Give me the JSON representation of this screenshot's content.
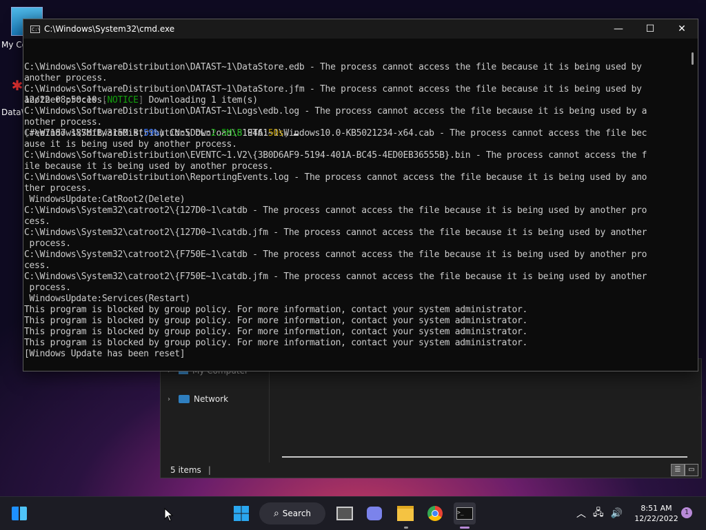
{
  "desktop": {
    "icons": [
      {
        "label": "My Co",
        "icon": "monitor-icon"
      },
      {
        "label": "DataW",
        "icon": "shortcut-icon"
      }
    ]
  },
  "explorer": {
    "nav_items": [
      {
        "label": "My Computer",
        "icon": "computer-icon"
      },
      {
        "label": "Network",
        "icon": "network-icon"
      }
    ],
    "status": "5 items"
  },
  "cmd": {
    "title": "C:\\Windows\\System32\\cmd.exe",
    "controls": {
      "minimize": "—",
      "maximize": "☐",
      "close": "✕"
    },
    "lines": [
      "C:\\Windows\\SoftwareDistribution\\DATAST~1\\DataStore.edb - The process cannot access the file because it is being used by",
      "another process.",
      "C:\\Windows\\SoftwareDistribution\\DATAST~1\\DataStore.jfm - The process cannot access the file because it is being used by",
      "another process.",
      "C:\\Windows\\SoftwareDistribution\\DATAST~1\\Logs\\edb.log - The process cannot access the file because it is being used by a",
      "nother process.",
      "C:\\Windows\\SoftwareDistribution\\Download\\819461~1\\Windows10.0-KB5021234-x64.cab - The process cannot access the file bec",
      "ause it is being used by another process.",
      "C:\\Windows\\SoftwareDistribution\\EVENTC~1.V2\\{3B0D6AF9-5194-401A-BC45-4ED0EB36555B}.bin - The process cannot access the f",
      "ile because it is being used by another process.",
      "C:\\Windows\\SoftwareDistribution\\ReportingEvents.log - The process cannot access the file because it is being used by ano",
      "ther process.",
      " WindowsUpdate:CatRoot2(Delete)",
      "C:\\Windows\\System32\\catroot2\\{127D0~1\\catdb - The process cannot access the file because it is being used by another pro",
      "cess.",
      "C:\\Windows\\System32\\catroot2\\{127D0~1\\catdb.jfm - The process cannot access the file because it is being used by another",
      " process.",
      "C:\\Windows\\System32\\catroot2\\{F750E~1\\catdb - The process cannot access the file because it is being used by another pro",
      "cess.",
      "C:\\Windows\\System32\\catroot2\\{F750E~1\\catdb.jfm - The process cannot access the file because it is being used by another",
      " process.",
      " WindowsUpdate:Services(Restart)",
      "This program is blocked by group policy. For more information, contact your system administrator.",
      "This program is blocked by group policy. For more information, contact your system administrator.",
      "This program is blocked by group policy. For more information, contact your system administrator.",
      "This program is blocked by group policy. For more information, contact your system administrator.",
      "[Windows Update has been reset]",
      ""
    ],
    "notice_line": {
      "time": "12/22 08:50:10 ",
      "open": "[",
      "tag": "NOTICE",
      "close": "]",
      "rest": " Downloading 1 item(s)"
    },
    "progress_line": {
      "open": "[",
      "gid": "#ee7187 187MiB/315MiB(",
      "pct": "59%",
      "mid": ") CN:5 DL:",
      "dl": "2.5MiB",
      "eta_label": " ETA:",
      "eta": "50s",
      "close": "]"
    }
  },
  "taskbar": {
    "search_label": "Search",
    "apps": [
      "widgets-icon",
      "windows-start-icon",
      "task-view-icon",
      "chat-icon",
      "file-explorer-icon",
      "chrome-icon",
      "terminal-icon"
    ],
    "clock_time": "8:51 AM",
    "clock_date": "12/22/2022",
    "notification_count": "1"
  }
}
